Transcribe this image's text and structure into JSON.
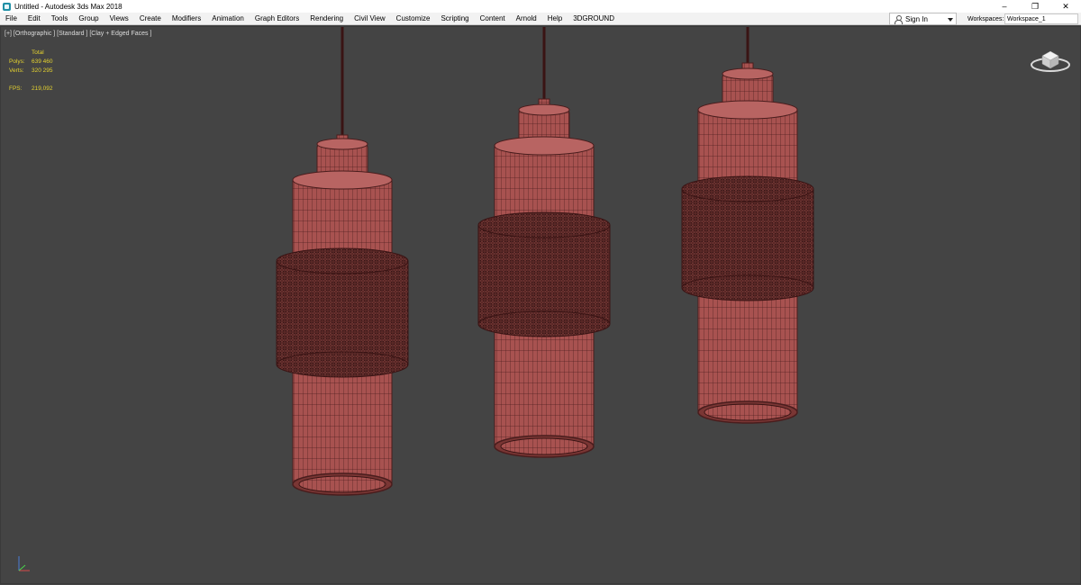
{
  "window": {
    "title": "Untitled - Autodesk 3ds Max 2018",
    "controls": [
      "–",
      "❐",
      "✕"
    ]
  },
  "menu": [
    "File",
    "Edit",
    "Tools",
    "Group",
    "Views",
    "Create",
    "Modifiers",
    "Animation",
    "Graph Editors",
    "Rendering",
    "Civil View",
    "Customize",
    "Scripting",
    "Content",
    "Arnold",
    "Help",
    "3DGROUND"
  ],
  "account": {
    "signin_label": "Sign In"
  },
  "workspaces": {
    "label": "Workspaces:",
    "value": "Workspace_1"
  },
  "viewport": {
    "label": "[+] [Orthographic ] [Standard ] [Clay + Edged Faces ]",
    "stats": {
      "header": "Total",
      "polys_label": "Polys:",
      "polys_value": "639 460",
      "verts_label": "Verts:",
      "verts_value": "320 295",
      "fps_label": "FPS:",
      "fps_value": "219,092"
    }
  },
  "colors": {
    "mesh": "#a85250",
    "wire": "#4a1d1d",
    "band": "#6e3432",
    "viewport_bg": "#444444",
    "stats_text": "#e5d22f"
  },
  "icons": {
    "viewcube": "viewcube-icon",
    "axis": "axis-tripod-icon",
    "app": "3dsmax-app-icon"
  }
}
